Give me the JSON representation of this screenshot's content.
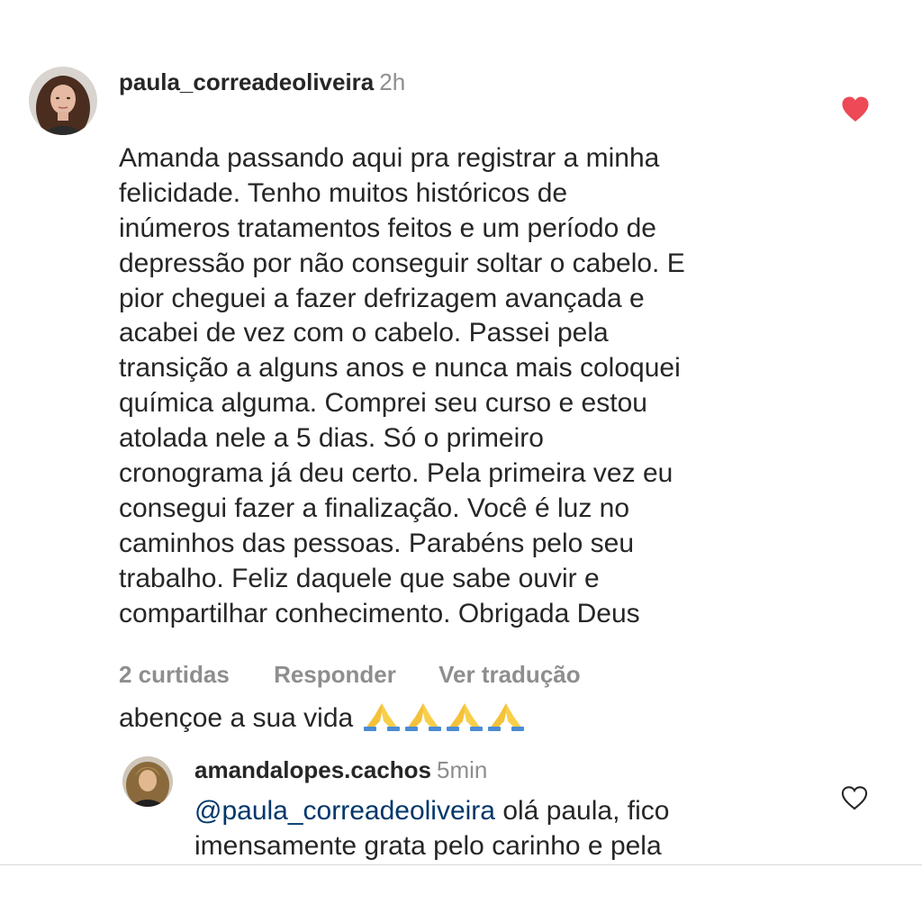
{
  "comment1": {
    "username": "paula_correadeoliveira",
    "time": "2h",
    "text": "Amanda passando aqui pra registrar a minha\nfelicidade. Tenho muitos históricos de\ninúmeros tratamentos feitos e um período de\ndepressão por não conseguir soltar o cabelo. E\npior cheguei a fazer defrizagem avançada e\nacabei de vez com o cabelo. Passei pela\ntransição a alguns anos e nunca mais coloquei\nquímica alguma. Comprei seu curso e estou\natolada nele a 5 dias. Só o primeiro\ncronograma já deu certo. Pela primeira vez eu\nconsegui fazer a finalização. Você é luz no\ncaminhos das pessoas. Parabéns pelo seu\ntrabalho. Feliz daquele que sabe ouvir e\ncompartilhar conhecimento. Obrigada Deus",
    "last_line": "abençoe a sua vida",
    "emojis": [
      "🙏",
      "🙏",
      "🙏",
      "🙏"
    ],
    "likes": "2 curtidas",
    "reply_label": "Responder",
    "translate_label": "Ver tradução",
    "liked": true,
    "heart_color": "#ed4956",
    "heart_icon": "heart-filled-icon"
  },
  "comment2": {
    "username": "amandalopes.cachos",
    "time": "5min",
    "mention": "@paula_correadeoliveira",
    "text_after_mention": " olá paula, fico",
    "text_line2": "imensamente grata pelo carinho e pela",
    "liked": false,
    "heart_icon": "heart-outline-icon"
  },
  "colors": {
    "text": "#262626",
    "muted": "#8e8e8e",
    "mention": "#00376b",
    "like_red": "#ed4956"
  }
}
